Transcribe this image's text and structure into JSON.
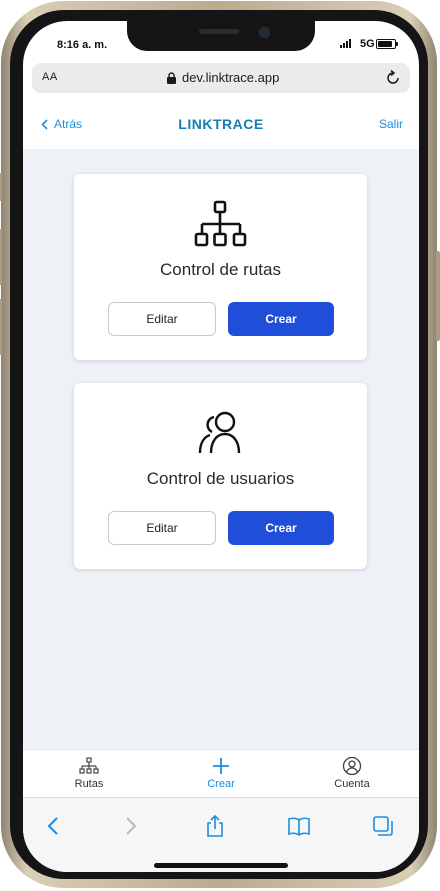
{
  "status": {
    "time": "8:16 a. m.",
    "network": "5G"
  },
  "browser": {
    "text_size": "AA",
    "url": "dev.linktrace.app"
  },
  "header": {
    "back_label": "Atrás",
    "brand": "LINKTRACE",
    "logout_label": "Salir"
  },
  "cards": [
    {
      "title": "Control de rutas",
      "icon": "sitemap-icon",
      "edit_label": "Editar",
      "create_label": "Crear"
    },
    {
      "title": "Control de usuarios",
      "icon": "users-icon",
      "edit_label": "Editar",
      "create_label": "Crear"
    }
  ],
  "tabbar": {
    "items": [
      {
        "label": "Rutas",
        "icon": "sitemap-icon"
      },
      {
        "label": "Crear",
        "icon": "plus-icon",
        "active": true
      },
      {
        "label": "Cuenta",
        "icon": "user-circle-icon"
      }
    ]
  },
  "colors": {
    "accent": "#1a8ee0",
    "brand": "#157db5",
    "primary_button": "#1f4fd8",
    "background": "#eef2f7"
  }
}
